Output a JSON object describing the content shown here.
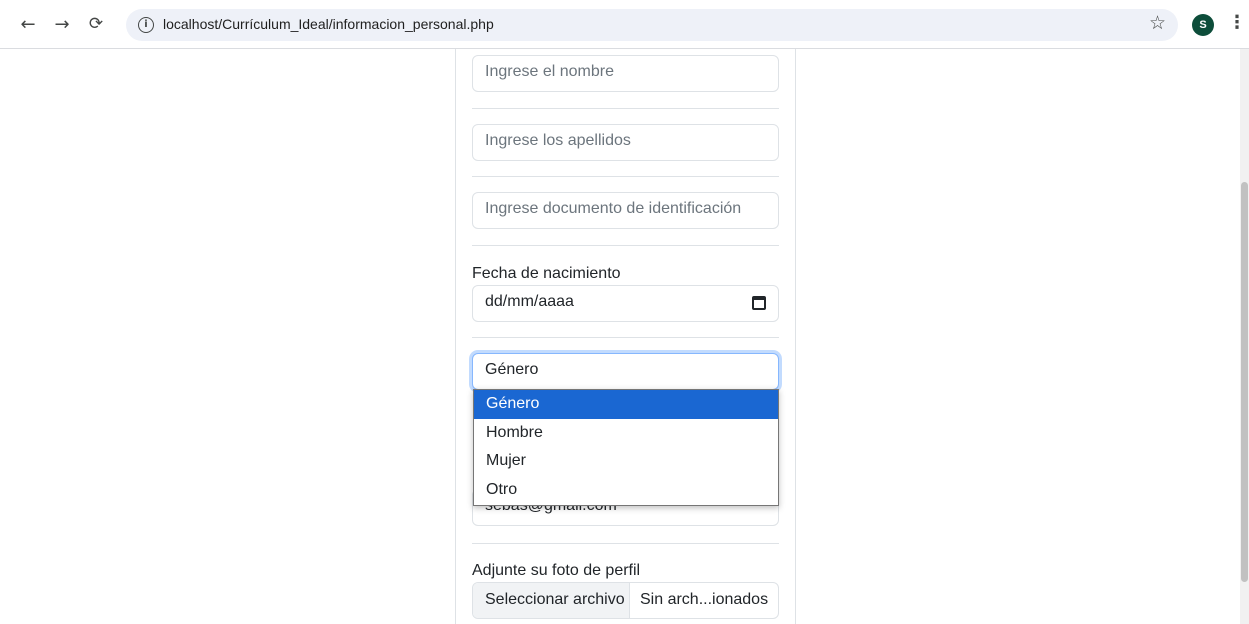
{
  "browser": {
    "url": "localhost/Currículum_Ideal/informacion_personal.php",
    "profile_initial": "S",
    "icons": [
      "back-arrow-icon",
      "forward-arrow-icon",
      "reload-icon",
      "info-icon",
      "bookmark-star-icon",
      "more-menu-icon",
      "calendar-icon"
    ]
  },
  "form": {
    "nombre_placeholder": "Ingrese el nombre",
    "apellidos_placeholder": "Ingrese los apellidos",
    "documento_placeholder": "Ingrese documento de identificación",
    "fecha_label": "Fecha de nacimiento",
    "fecha_value": "dd/mm/aaaa",
    "genero_value": "Género",
    "genero_options": [
      "Género",
      "Hombre",
      "Mujer",
      "Otro"
    ],
    "email_value": "sebas@gmail.com",
    "foto_label": "Adjunte su foto de perfil",
    "file_button": "Seleccionar archivo",
    "file_status": "Sin arch...ionados"
  },
  "colors": {
    "selected_option": "#1a67d2",
    "focus_border": "#86b7fe",
    "avatar": "#0d4d3a"
  }
}
